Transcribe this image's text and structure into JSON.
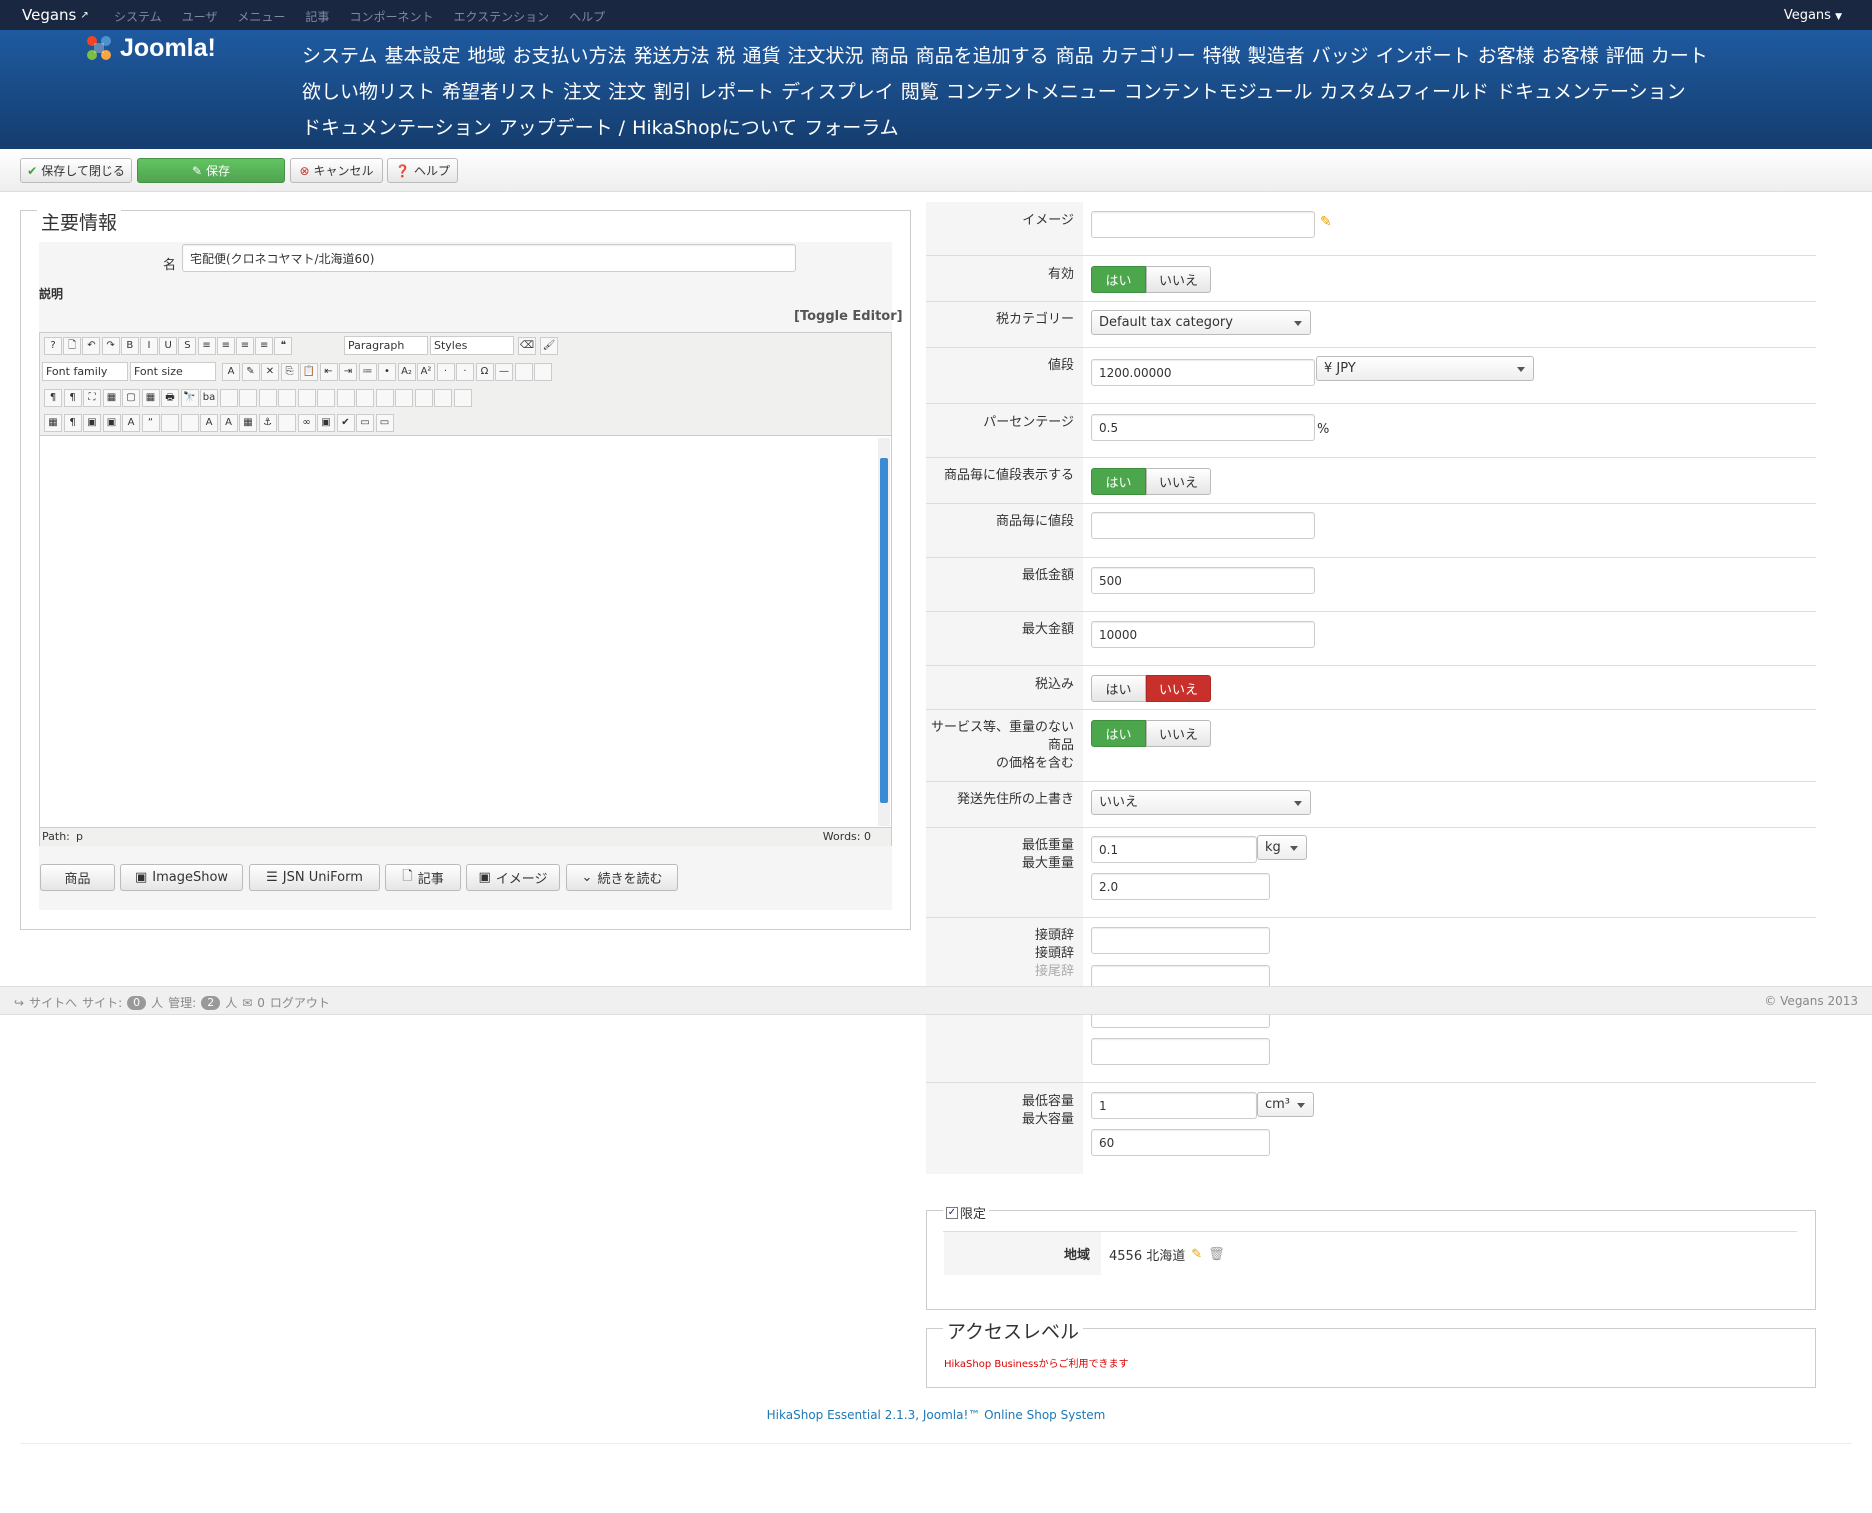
{
  "topbar": {
    "brand": "Vegans",
    "menu": [
      "システム",
      "ユーザ",
      "メニュー",
      "記事",
      "コンポーネント",
      "エクステンション",
      "ヘルプ"
    ],
    "user": "Vegans"
  },
  "header": {
    "logo": "Joomla!",
    "nav": [
      "システム",
      "基本設定",
      "地域",
      "お支払い方法",
      "発送方法",
      "税",
      "通貨",
      "注文状況",
      "商品",
      "商品を追加する",
      "商品",
      "カテゴリー",
      "特徴",
      "製造者",
      "バッジ",
      "インポート",
      "お客様",
      "お客様",
      "評価",
      "カート",
      "欲しい物リスト",
      "希望者リスト",
      "注文",
      "注文",
      "割引",
      "レポート",
      "ディスプレイ",
      "閲覧",
      "コンテントメニュー",
      "コンテントモジュール",
      "カスタムフィールド",
      "ドキュメンテーション",
      "ドキュメンテーション",
      "アップデート /",
      "HikaShopについて",
      "フォーラム"
    ]
  },
  "toolbar": {
    "save_close": "保存して閉じる",
    "save": "保存",
    "cancel": "キャンセル",
    "help": "ヘルプ"
  },
  "main": {
    "legend": "主要情報",
    "name_label": "名",
    "name_value": "宅配便(クロネコヤマト/北海道60)",
    "desc_label": "説明",
    "toggle_editor": "[Toggle Editor]",
    "editor": {
      "format": "Paragraph",
      "styles": "Styles",
      "font_family": "Font family",
      "font_size": "Font size",
      "path_label": "Path:",
      "path_value": "p",
      "words": "Words: 0"
    },
    "buttons": [
      "商品",
      "ImageShow",
      "JSN UniForm",
      "記事",
      "イメージ",
      "続きを読む"
    ]
  },
  "fields": {
    "image": "イメージ",
    "published": "有効",
    "yes": "はい",
    "no": "いいえ",
    "tax_category": "税カテゴリー",
    "tax_category_value": "Default tax category",
    "price": "値段",
    "price_value": "1200.00000",
    "currency": "¥ JPY",
    "percentage": "パーセンテージ",
    "percentage_value": "0.5",
    "percent_sign": "%",
    "per_product": "商品毎に値段表示する",
    "per_product_price": "商品毎に値段",
    "min_price": "最低金額",
    "min_price_value": "500",
    "max_price": "最大金額",
    "max_price_value": "10000",
    "tax_incl": "税込み",
    "virtual_label_1": "サービス等、重量のない",
    "virtual_label_2": "商品",
    "virtual_label_3": "の価格を含む",
    "override_addr": "発送先住所の上書き",
    "override_value": "いいえ",
    "min_weight": "最低重量",
    "max_weight": "最大重量",
    "min_weight_value": "0.1",
    "weight_unit": "kg",
    "max_weight_value": "2.0",
    "prefix1": "接頭辞",
    "prefix2": "接頭辞",
    "suffix": "接尾辞",
    "min_volume": "最低容量",
    "max_volume": "最大容量",
    "min_volume_value": "1",
    "volume_unit": "cm³",
    "max_volume_value": "60"
  },
  "restriction": {
    "legend": "限定",
    "zone_label": "地域",
    "zone_value": "4556 北海道"
  },
  "access": {
    "legend": "アクセスレベル",
    "note": "HikaShop Businessからご利用できます"
  },
  "status": {
    "site_link": "サイトへ",
    "site": "サイト:",
    "site_count": "0",
    "unit": "人",
    "admin": "管理:",
    "admin_count": "2",
    "messages": "0",
    "logout": "ログアウト",
    "copyright": "© Vegans 2013"
  },
  "footer": "HikaShop Essential 2.1.3, Joomla!™ Online Shop System",
  "colors": {
    "header": "#1e5aa0",
    "green": "#4ca64c",
    "red": "#c9302c",
    "link": "#1e78b4"
  }
}
